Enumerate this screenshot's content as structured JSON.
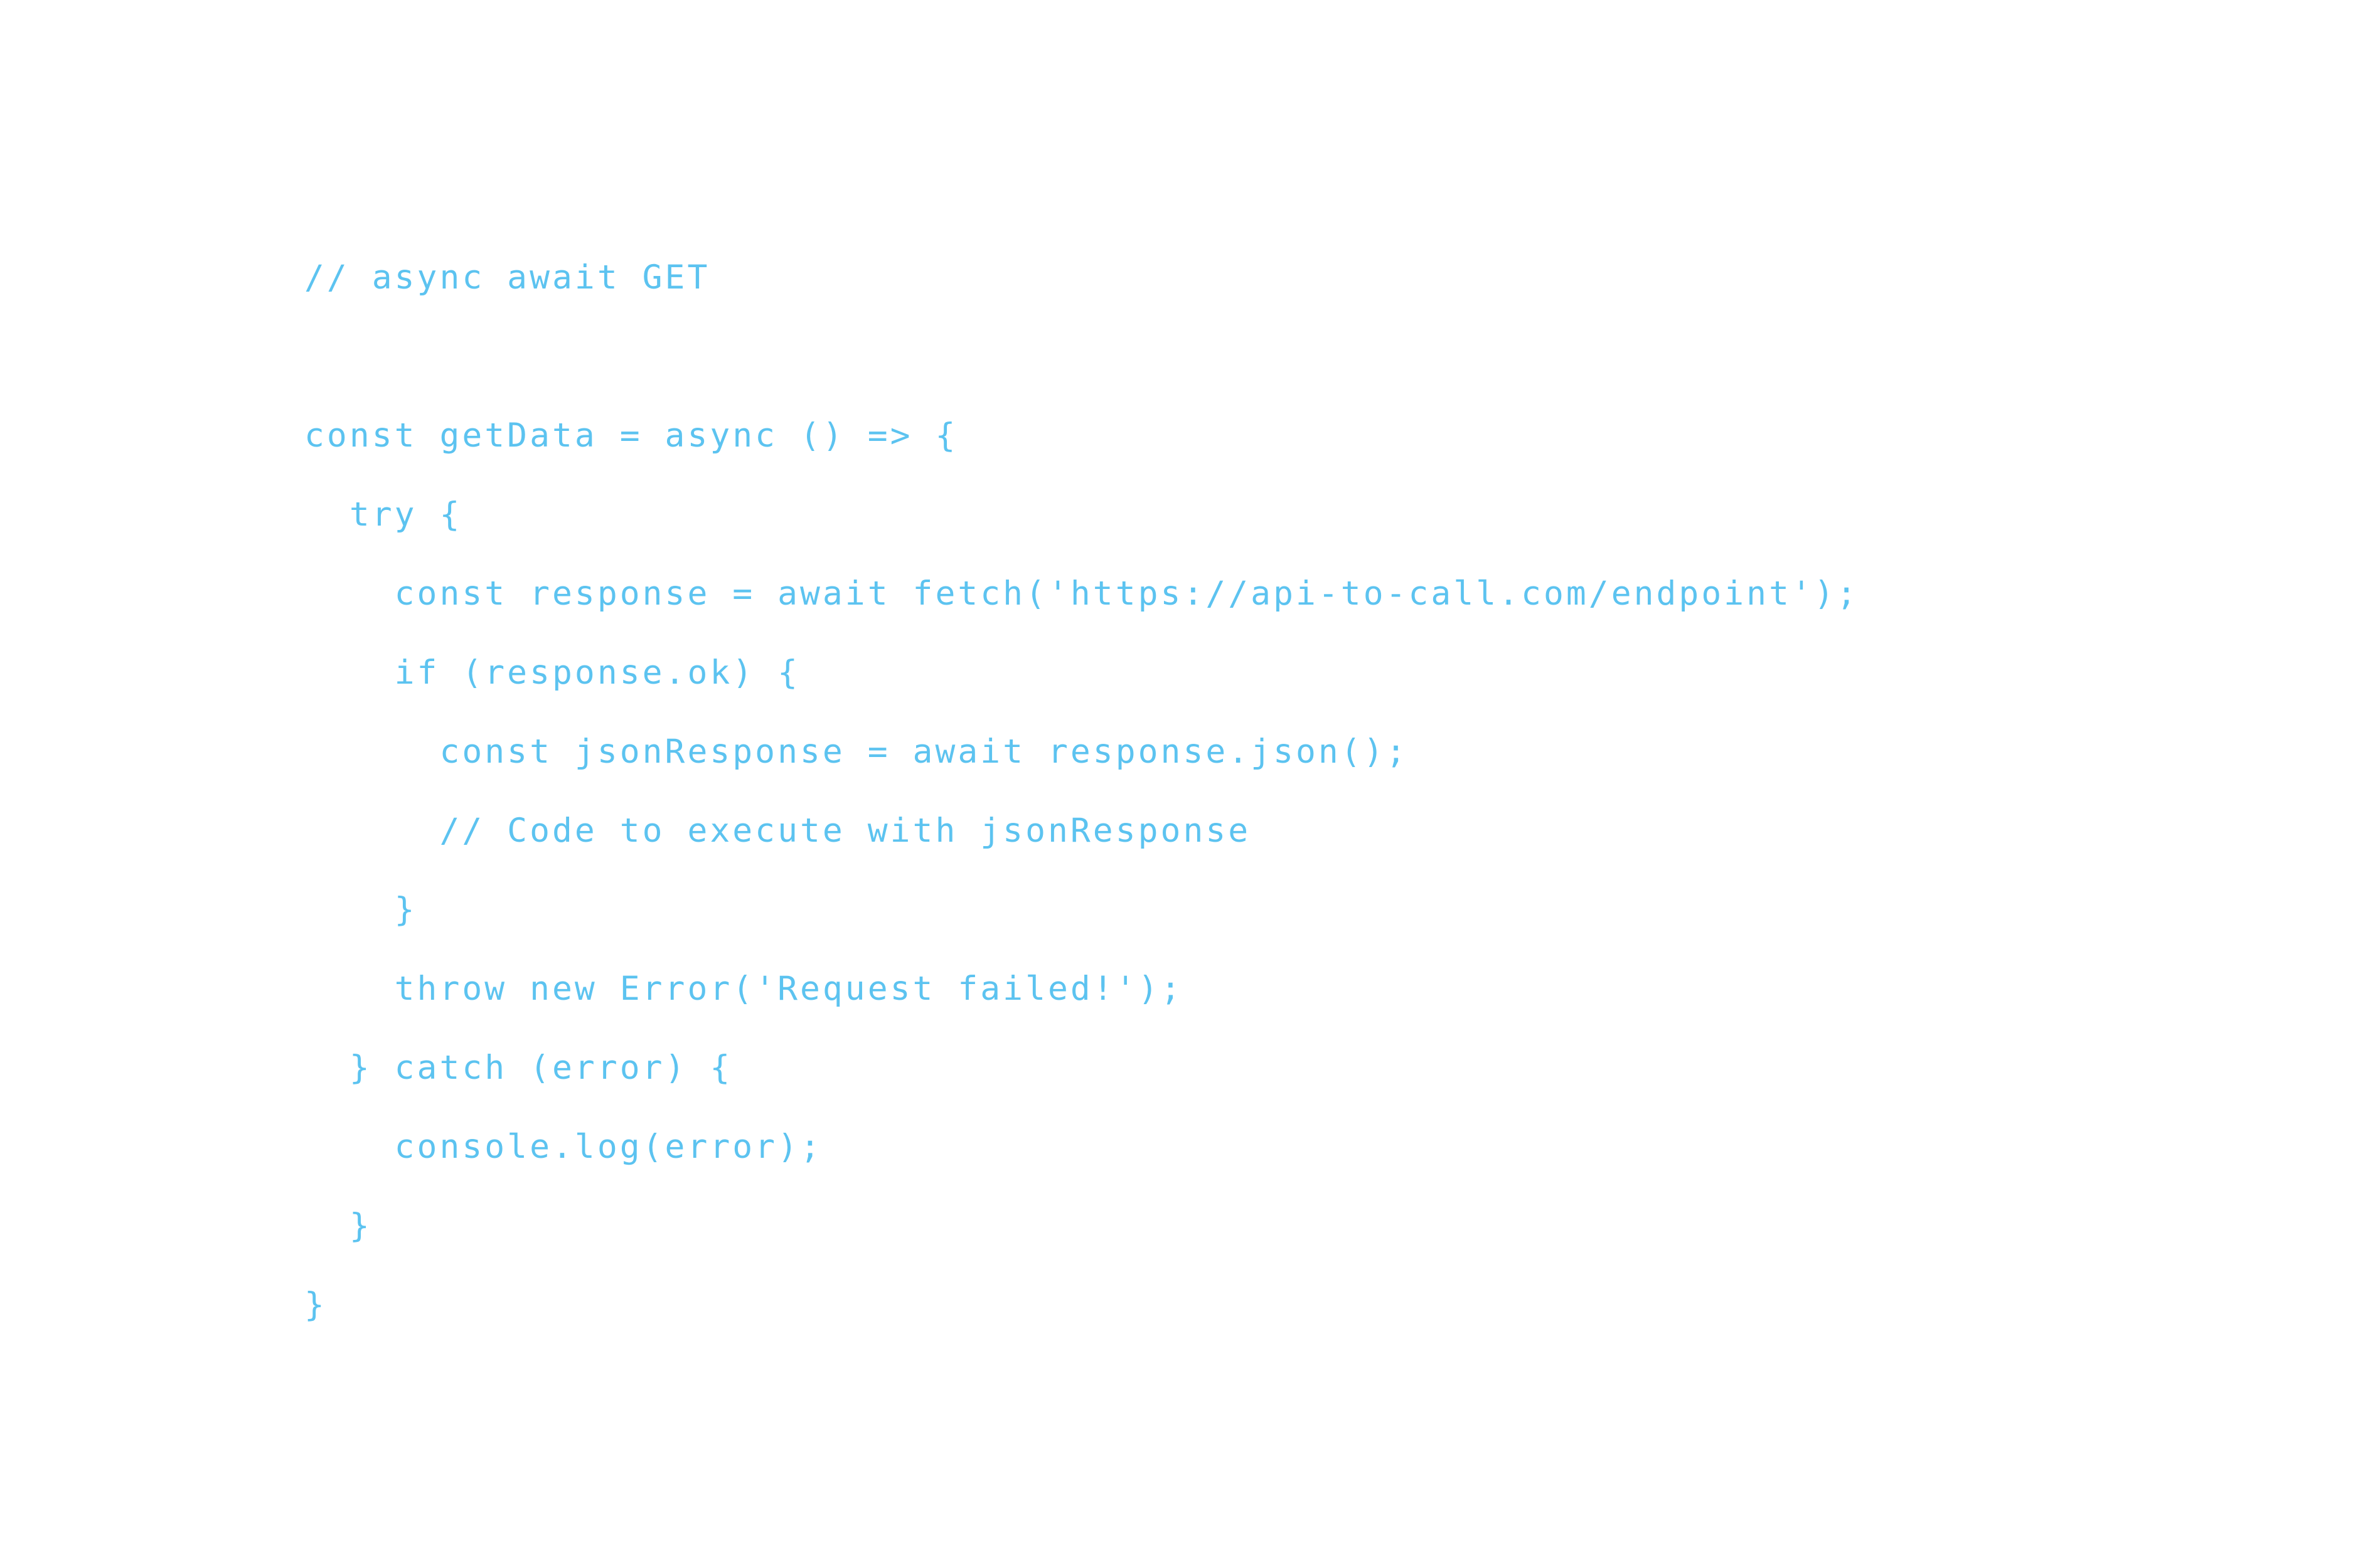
{
  "code": {
    "lines": [
      "// async await GET",
      "",
      "const getData = async () => {",
      "  try {",
      "    const response = await fetch('https://api-to-call.com/endpoint');",
      "    if (response.ok) {",
      "      const jsonResponse = await response.json();",
      "      // Code to execute with jsonResponse",
      "    }",
      "    throw new Error('Request failed!');",
      "  } catch (error) {",
      "    console.log(error);",
      "  }",
      "}"
    ]
  },
  "colors": {
    "text": "#5cc3f0",
    "background": "#ffffff"
  }
}
